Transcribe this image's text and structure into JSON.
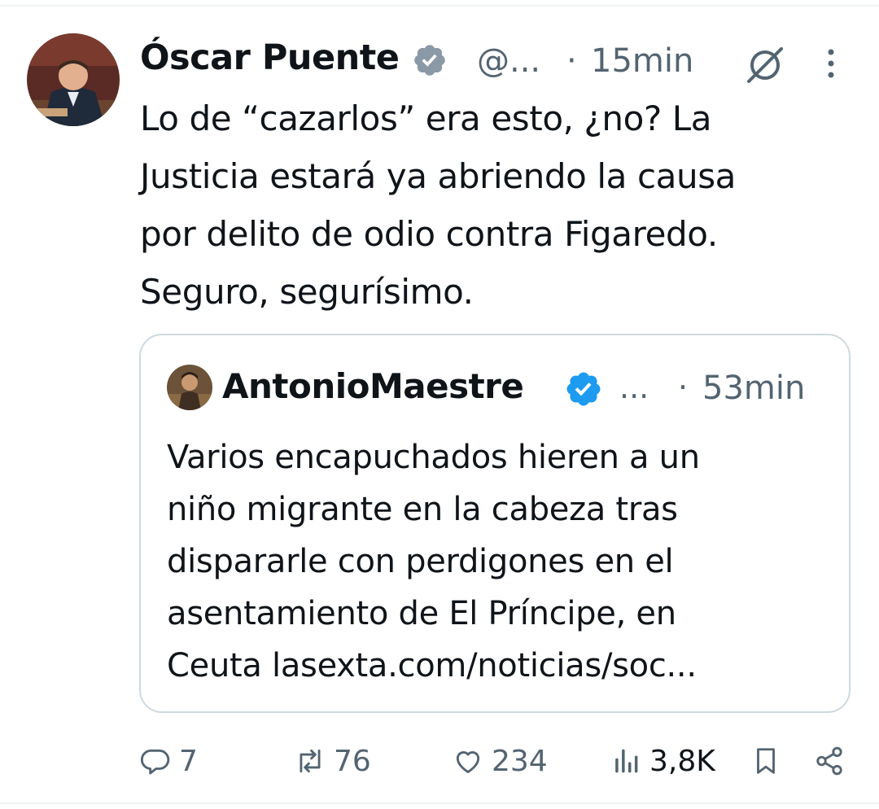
{
  "tweet": {
    "author_name": "Óscar Puente",
    "handle": "@...",
    "separator": "·",
    "time": "15min",
    "text_lines": [
      "Lo de “cazarlos” era esto, ¿no? La",
      "Justicia estará ya abriendo la causa",
      "por delito de odio contra Figaredo.",
      "Seguro, segurísimo."
    ],
    "icons": {
      "verified": "verified-badge-icon",
      "grok": "grok-icon",
      "more": "more-vertical-icon"
    }
  },
  "quote": {
    "author_name": "AntonioMaestre",
    "handle": "...",
    "separator": "·",
    "time": "53min",
    "text_lines": [
      "Varios encapuchados hieren a un",
      "niño migrante en la cabeza tras",
      "dispararle con perdigones en el",
      "asentamiento de El Príncipe, en",
      "Ceuta lasexta.com/noticias/soc..."
    ]
  },
  "actions": {
    "replies": "7",
    "reposts": "76",
    "likes": "234",
    "views": "3,8K"
  },
  "colors": {
    "text": "#0f1419",
    "muted": "#536471",
    "border": "#cfd9de",
    "verified_primary": "#8b98a5",
    "verified_quote": "#1d9bf0"
  }
}
